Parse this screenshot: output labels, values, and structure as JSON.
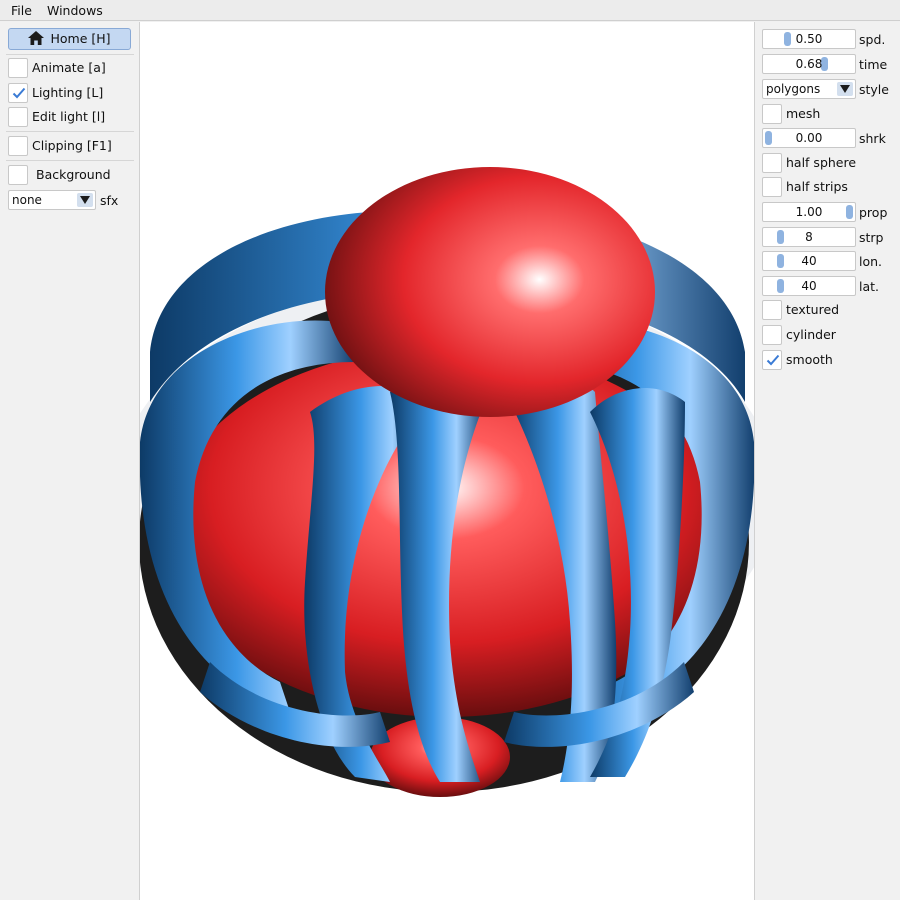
{
  "menu": {
    "file": "File",
    "windows": "Windows"
  },
  "left_panel": {
    "home": "Home [H]",
    "animate": "Animate [a]",
    "lighting": "Lighting [L]",
    "edit_light": "Edit light [l]",
    "clipping": "Clipping [F1]",
    "background": "Background",
    "sfx_value": "none",
    "sfx_label": "sfx",
    "checked": {
      "animate": false,
      "lighting": true,
      "edit_light": false,
      "clipping": false,
      "background": false
    }
  },
  "right_panel": {
    "spd": {
      "value": "0.50",
      "label": "spd.",
      "fraction": 0.25
    },
    "time": {
      "value": "0.68",
      "label": "time",
      "fraction": 0.68
    },
    "style": {
      "value": "polygons",
      "label": "style"
    },
    "mesh": {
      "label": "mesh",
      "checked": false
    },
    "shrk": {
      "value": "0.00",
      "label": "shrk",
      "fraction": 0.0
    },
    "half_sphere": {
      "label": "half sphere",
      "checked": false
    },
    "half_strips": {
      "label": "half strips",
      "checked": false
    },
    "prop": {
      "value": "1.00",
      "label": "prop",
      "fraction": 1.0
    },
    "strp": {
      "value": "8",
      "label": "strp",
      "fraction": 0.0
    },
    "lon": {
      "value": "40",
      "label": "lon.",
      "fraction": 0.0
    },
    "lat": {
      "value": "40",
      "label": "lat.",
      "fraction": 0.0
    },
    "textured": {
      "label": "textured",
      "checked": false
    },
    "cylinder": {
      "label": "cylinder",
      "checked": false
    },
    "smooth": {
      "label": "smooth",
      "checked": true
    }
  },
  "colors": {
    "sphere_red": "#e0262a",
    "strip_blue": "#2f86d4",
    "accent": "#3a7bd5"
  }
}
